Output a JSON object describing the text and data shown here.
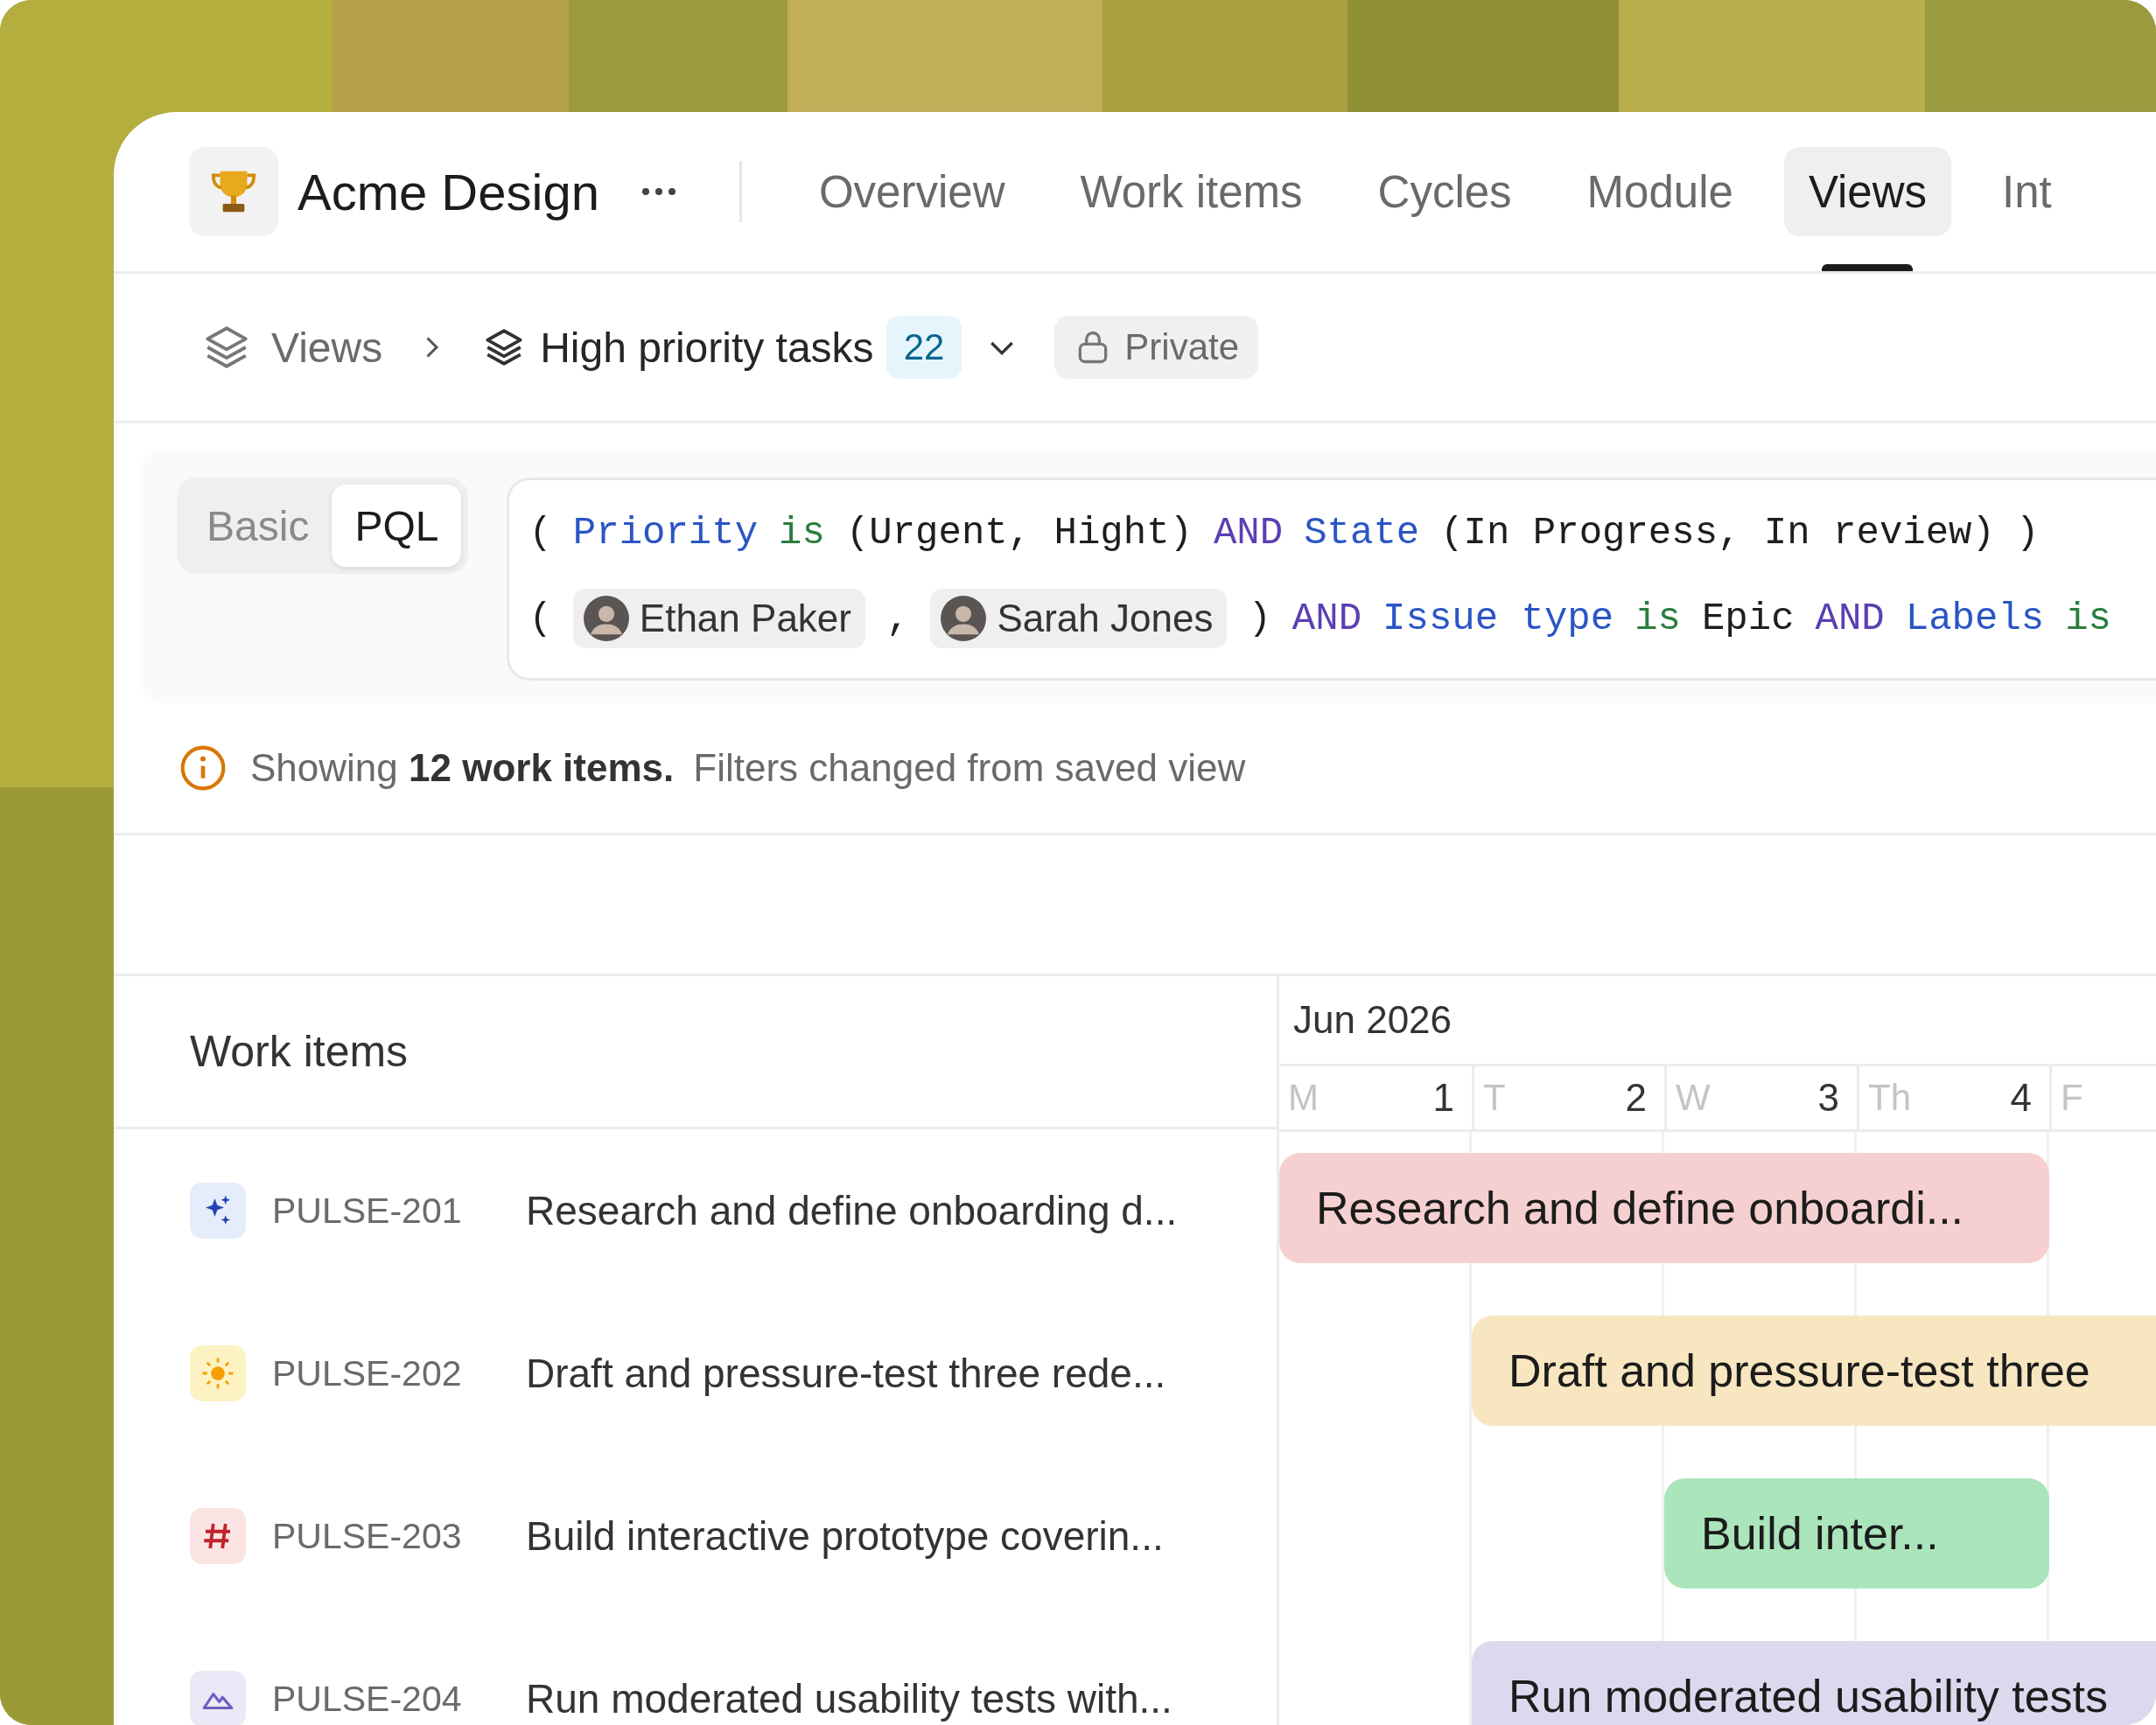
{
  "top_nav": {
    "project": {
      "name": "Acme Design"
    },
    "tabs": [
      {
        "label": "Overview",
        "selected": false
      },
      {
        "label": "Work items",
        "selected": false
      },
      {
        "label": "Cycles",
        "selected": false
      },
      {
        "label": "Module",
        "selected": false
      },
      {
        "label": "Views",
        "selected": true
      },
      {
        "label": "Int",
        "selected": false
      }
    ]
  },
  "breadcrumb": {
    "root": "Views",
    "view": "High priority tasks",
    "count": "22",
    "visibility": "Private"
  },
  "filter": {
    "modes": [
      {
        "label": "Basic",
        "selected": false
      },
      {
        "label": "PQL",
        "selected": true
      }
    ],
    "query_lines": [
      {
        "tokens": [
          {
            "kind": "text",
            "text": "("
          },
          {
            "kind": "field",
            "text": "Priority"
          },
          {
            "kind": "operator",
            "text": "is"
          },
          {
            "kind": "text",
            "text": "(Urgent, Hight)"
          },
          {
            "kind": "keyword",
            "text": "AND"
          },
          {
            "kind": "field",
            "text": "State"
          },
          {
            "kind": "text",
            "text": "(In Progress, In review)"
          },
          {
            "kind": "text",
            "text": ")"
          }
        ]
      },
      {
        "tokens": [
          {
            "kind": "text",
            "text": "("
          },
          {
            "kind": "person",
            "text": "Ethan Paker"
          },
          {
            "kind": "text",
            "text": ","
          },
          {
            "kind": "person",
            "text": "Sarah Jones"
          },
          {
            "kind": "text",
            "text": ")"
          },
          {
            "kind": "keyword",
            "text": "AND"
          },
          {
            "kind": "field",
            "text": "Issue type"
          },
          {
            "kind": "operator",
            "text": "is"
          },
          {
            "kind": "text",
            "text": "Epic"
          },
          {
            "kind": "keyword",
            "text": "AND"
          },
          {
            "kind": "field",
            "text": "Labels"
          },
          {
            "kind": "operator",
            "text": "is"
          }
        ]
      }
    ]
  },
  "notice": {
    "text": "Showing **12 work items.**",
    "detail": "Filters changed from saved view"
  },
  "gantt": {
    "list_title": "Work items",
    "month": "Jun 2026",
    "days": [
      {
        "weekday": "M",
        "date": "1"
      },
      {
        "weekday": "T",
        "date": "2"
      },
      {
        "weekday": "W",
        "date": "3"
      },
      {
        "weekday": "Th",
        "date": "4"
      },
      {
        "weekday": "F"
      }
    ],
    "items": [
      {
        "kind": "sparkle",
        "id": "PULSE-201",
        "title": "Research and define onboarding d...",
        "bar": {
          "text": "Research and define onboardi...",
          "color": "#f6d0d0",
          "covers": [
            true,
            true,
            true,
            true,
            false
          ]
        }
      },
      {
        "kind": "sun",
        "id": "PULSE-202",
        "title": "Draft and pressure-test three rede...",
        "bar": {
          "text": "Draft and pressure-test three",
          "color": "#f7e6c0",
          "covers": [
            false,
            true,
            true,
            true,
            true
          ]
        }
      },
      {
        "kind": "hash",
        "id": "PULSE-203",
        "title": "Build interactive prototype coverin...",
        "bar": {
          "text": "Build inter...",
          "color": "#abe5bb",
          "covers": [
            false,
            false,
            true,
            true,
            false
          ]
        }
      },
      {
        "kind": "mountain",
        "id": "PULSE-204",
        "title": "Run moderated usability tests with...",
        "bar": {
          "text": "Run moderated usability tests",
          "color": "#dcd8ee",
          "covers": [
            false,
            true,
            true,
            true,
            true
          ]
        }
      }
    ]
  }
}
